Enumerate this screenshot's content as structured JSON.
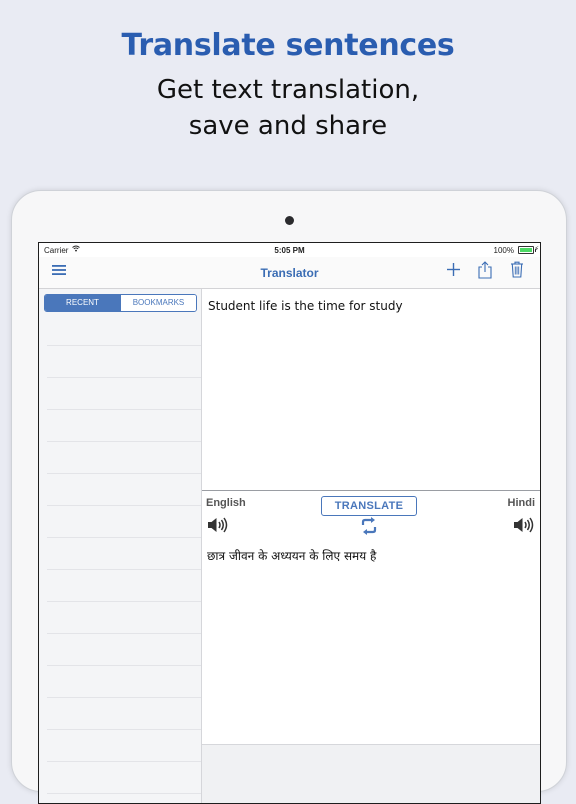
{
  "promo": {
    "title": "Translate sentences",
    "subtitle_line1": "Get text translation,",
    "subtitle_line2": "save and share"
  },
  "status_bar": {
    "carrier": "Carrier",
    "time": "5:05 PM",
    "battery": "100%"
  },
  "nav": {
    "title": "Translator"
  },
  "sidebar": {
    "tabs": [
      {
        "label": "RECENT",
        "active": true
      },
      {
        "label": "BOOKMARKS",
        "active": false
      }
    ]
  },
  "translator": {
    "source_text": "Student life is the time for study",
    "source_language": "English",
    "target_language": "Hindi",
    "translate_label": "TRANSLATE",
    "result_text": "छात्र जीवन के अध्ययन के लिए समय है"
  },
  "colors": {
    "accent": "#4a77bb",
    "promo_title": "#2a5db0",
    "background": "#e9ebf3",
    "battery": "#4cd964"
  },
  "icons": {
    "menu": "hamburger-menu-icon",
    "add": "plus-icon",
    "share": "share-icon",
    "trash": "trash-icon",
    "speaker": "speaker-icon",
    "swap": "swap-languages-icon",
    "wifi": "wifi-icon"
  }
}
